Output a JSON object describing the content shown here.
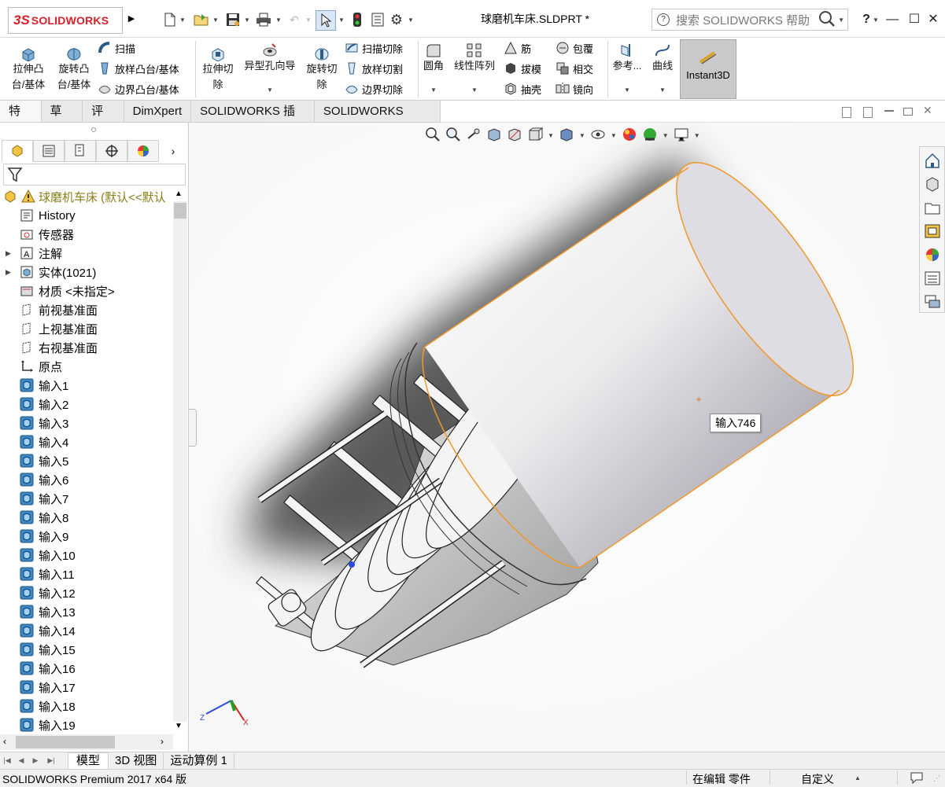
{
  "app": {
    "brand_ds": "3S",
    "brand_name": "SOLIDWORKS",
    "document_title": "球磨机车床.SLDPRT *",
    "help_search_placeholder": "搜索 SOLIDWORKS 帮助",
    "help_label": "?",
    "window_buttons": [
      "—",
      "☐",
      "✕"
    ]
  },
  "command_manager": {
    "col1": [
      "拉伸凸",
      "台/基体"
    ],
    "col2": [
      "旋转凸",
      "台/基体"
    ],
    "row_sweep": "扫描",
    "row_loft": "放样凸台/基体",
    "row_boundary": "边界凸台/基体",
    "extrude_cut": [
      "拉伸切",
      "除"
    ],
    "hole_wizard": "异型孔向导",
    "revolve_cut": [
      "旋转切",
      "除"
    ],
    "swept_cut": "扫描切除",
    "lofted_cut": "放样切割",
    "boundary_cut": "边界切除",
    "fillet": "圆角",
    "linear_pattern": "线性阵列",
    "rib": "筋",
    "draft": "拔模",
    "shell": "抽壳",
    "wrap": "包覆",
    "intersect": "相交",
    "mirror": "镜向",
    "reference": "参考...",
    "curves": "曲线",
    "instant3d": "Instant3D"
  },
  "tabs": [
    "特征",
    "草图",
    "评估",
    "DimXpert",
    "SOLIDWORKS 插件",
    "SOLIDWORKS MBD"
  ],
  "tree": {
    "root": "球磨机车床  (默认<<默认",
    "items": [
      {
        "label": "History",
        "icon": "history-icon",
        "expandable": false
      },
      {
        "label": "传感器",
        "icon": "sensor-icon",
        "expandable": false
      },
      {
        "label": "注解",
        "icon": "annotation-icon",
        "expandable": true
      },
      {
        "label": "实体(1021)",
        "icon": "solid-bodies-icon",
        "expandable": true
      },
      {
        "label": "材质 <未指定>",
        "icon": "material-icon",
        "expandable": false
      },
      {
        "label": "前视基准面",
        "icon": "plane-icon",
        "expandable": false
      },
      {
        "label": "上视基准面",
        "icon": "plane-icon",
        "expandable": false
      },
      {
        "label": "右视基准面",
        "icon": "plane-icon",
        "expandable": false
      },
      {
        "label": "原点",
        "icon": "origin-icon",
        "expandable": false
      },
      {
        "label": "输入1",
        "icon": "imported-body-icon",
        "expandable": false
      },
      {
        "label": "输入2",
        "icon": "imported-body-icon",
        "expandable": false
      },
      {
        "label": "输入3",
        "icon": "imported-body-icon",
        "expandable": false
      },
      {
        "label": "输入4",
        "icon": "imported-body-icon",
        "expandable": false
      },
      {
        "label": "输入5",
        "icon": "imported-body-icon",
        "expandable": false
      },
      {
        "label": "输入6",
        "icon": "imported-body-icon",
        "expandable": false
      },
      {
        "label": "输入7",
        "icon": "imported-body-icon",
        "expandable": false
      },
      {
        "label": "输入8",
        "icon": "imported-body-icon",
        "expandable": false
      },
      {
        "label": "输入9",
        "icon": "imported-body-icon",
        "expandable": false
      },
      {
        "label": "输入10",
        "icon": "imported-body-icon",
        "expandable": false
      },
      {
        "label": "输入11",
        "icon": "imported-body-icon",
        "expandable": false
      },
      {
        "label": "输入12",
        "icon": "imported-body-icon",
        "expandable": false
      },
      {
        "label": "输入13",
        "icon": "imported-body-icon",
        "expandable": false
      },
      {
        "label": "输入14",
        "icon": "imported-body-icon",
        "expandable": false
      },
      {
        "label": "输入15",
        "icon": "imported-body-icon",
        "expandable": false
      },
      {
        "label": "输入16",
        "icon": "imported-body-icon",
        "expandable": false
      },
      {
        "label": "输入17",
        "icon": "imported-body-icon",
        "expandable": false
      },
      {
        "label": "输入18",
        "icon": "imported-body-icon",
        "expandable": false
      },
      {
        "label": "输入19",
        "icon": "imported-body-icon",
        "expandable": false
      }
    ]
  },
  "graphics": {
    "tooltip": "输入746",
    "triad": {
      "x": "X",
      "y": "Y",
      "z": "Z"
    },
    "highlight_color": "#f0982a"
  },
  "bottom_tabs": [
    "模型",
    "3D 视图",
    "运动算例 1"
  ],
  "status": {
    "product": "SOLIDWORKS Premium 2017 x64 版",
    "mode": "在编辑 零件",
    "units": "自定义"
  }
}
